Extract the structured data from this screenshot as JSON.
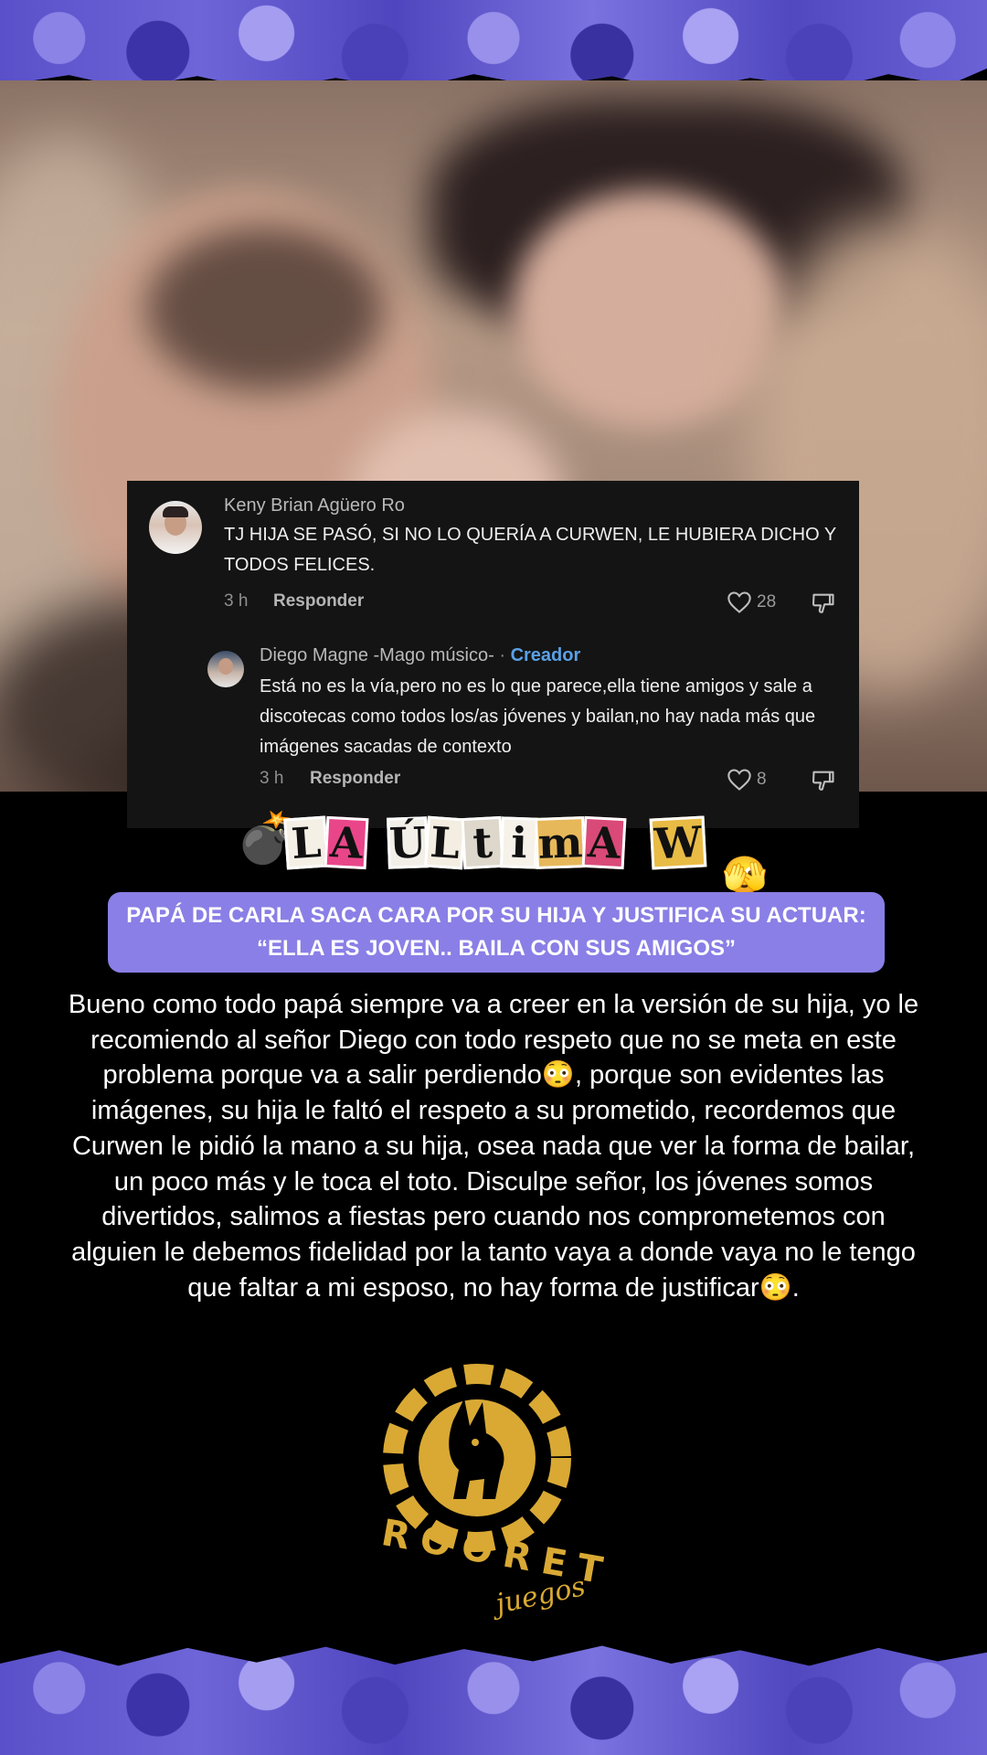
{
  "comment_card": {
    "comment": {
      "author": "Keny Brian Agüero Ro",
      "text": "TJ HIJA SE PASÓ, SI NO LO QUERÍA A CURWEN, LE HUBIERA DICHO Y TODOS FELICES.",
      "time": "3 h",
      "reply_label": "Responder",
      "likes": "28"
    },
    "reply": {
      "author": "Diego Magne -Mago músico-",
      "separator": "·",
      "creator_badge": "Creador",
      "text": "Está no es la vía,pero no es lo que parece,ella tiene amigos y sale a discotecas como todos los/as jóvenes y bailan,no hay nada más que imágenes sacadas de contexto",
      "time": "3 h",
      "reply_label": "Responder",
      "likes": "8"
    }
  },
  "banner": {
    "title": "LA ÚLTIMA W",
    "letters": [
      "L",
      "A",
      "Ú",
      "L",
      "t",
      "i",
      "m",
      "A",
      "W"
    ],
    "emoji_bomb": "💣",
    "emoji_face": "🫣"
  },
  "headline": "PAPÁ DE CARLA SACA CARA POR SU HIJA Y JUSTIFICA SU ACTUAR: “ELLA ES JOVEN.. BAILA CON SUS AMIGOS”",
  "body_text": "Bueno como todo papá siempre va a creer en la versión de su hija, yo le recomiendo al señor Diego con todo respeto que no se meta en este problema porque va a salir perdiendo😳, porque son evidentes las imágenes, su hija le faltó el respeto a su prometido, recordemos que Curwen le pidió la mano a su hija, osea nada que ver la forma de bailar, un poco más y le toca el toto. Disculpe señor, los jóvenes somos divertidos, salimos a fiestas pero cuando nos comprometemos con alguien le debemos fidelidad por la tanto vaya a donde vaya no le tengo que faltar a mi esposo, no hay forma de justificar😳.",
  "logo": {
    "brand": "ROORET",
    "sub": "juegos",
    "color": "#d9a934"
  },
  "colors": {
    "collage": "#5a50c9",
    "headline_bg": "#8a7fe6",
    "card_bg": "#141414",
    "creator": "#5aa0e6"
  }
}
